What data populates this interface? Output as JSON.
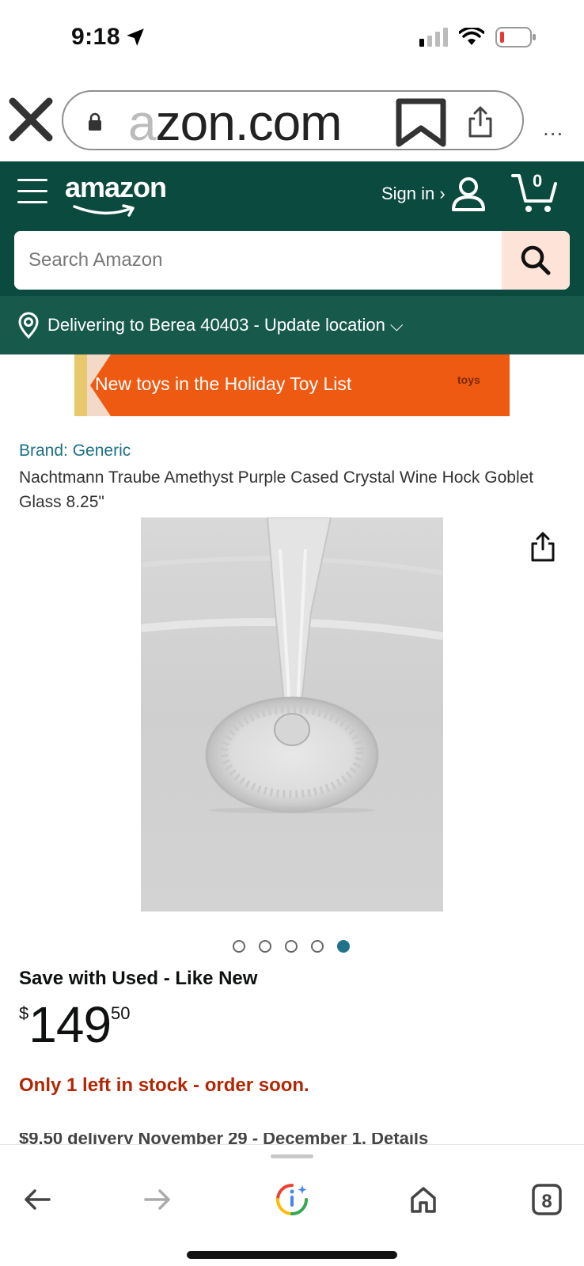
{
  "status_bar": {
    "time": "9:18",
    "icons": [
      "location-arrow-icon",
      "signal-icon",
      "wifi-icon",
      "battery-low-icon"
    ]
  },
  "browser": {
    "url_text_faded": "a",
    "url_text": "zon.com",
    "more_label": "..."
  },
  "header": {
    "logo": "amazon",
    "signin_label": "Sign in ›",
    "cart_count": "0",
    "search_placeholder": "Search Amazon",
    "colors": {
      "header_bg": "#0b4a3e",
      "delivery_bg": "#175a4c",
      "search_button": "#fde3d8"
    }
  },
  "delivery": {
    "text": "Delivering to Berea 40403 - Update location ⌵"
  },
  "banner": {
    "text": "New toys in the Holiday Toy List",
    "badge": "toys",
    "color": "#ef5a12"
  },
  "product": {
    "brand": "Brand: Generic",
    "title": "Nachtmann Traube Amethyst Purple Cased Crystal Wine Hock Goblet Glass 8.25\"",
    "image_count": 5,
    "active_image": 5,
    "save_line": "Save with Used - Like New",
    "price_symbol": "$",
    "price_whole": "149",
    "price_fraction": "50",
    "stock": "Only 1 left in stock - order soon.",
    "cut_text": "$9.50 delivery November 29 - December 1. Details"
  },
  "bottom_toolbar": {
    "icons": [
      "back-arrow-icon",
      "forward-arrow-icon",
      "google-lens-icon",
      "home-icon",
      "tabs-icon"
    ],
    "tab_count": "8"
  }
}
